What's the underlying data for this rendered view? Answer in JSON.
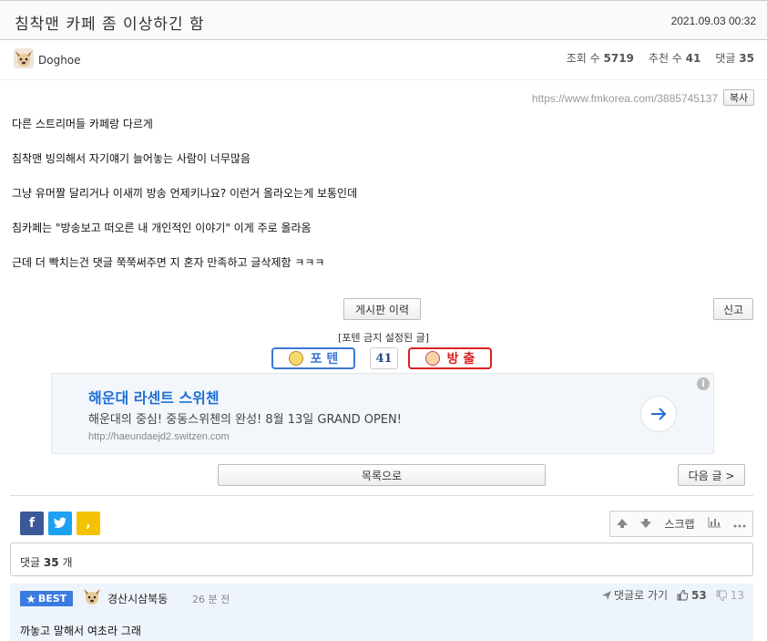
{
  "post": {
    "title": "침착맨 카페 좀 이상하긴 함",
    "datetime": "2021.09.03 00:32",
    "author": "Doghoe",
    "stats": {
      "views_label": "조회 수",
      "views": "5719",
      "recommend_label": "추천 수",
      "recommend": "41",
      "comments_label": "댓글",
      "comments": "35"
    },
    "url": "https://www.fmkorea.com/3885745137",
    "copy_label": "복사",
    "paragraphs": [
      "다른 스트리머들 카페랑 다르게",
      "침착맨 빙의해서 자기얘기 늘어놓는 사람이 너무많음",
      "그냥 유머짤 달리거나 이새끼 방송 언제키나요? 이런거 올라오는게 보통인데",
      "침카페는 \"방송보고 떠오른 내 개인적인 이야기\" 이게 주로 올라옴",
      "근데 더 빡치는건 댓글 쭉쭉써주면 지 혼자 만족하고 글삭제함 ㅋㅋㅋ"
    ]
  },
  "actions": {
    "history_label": "게시판 이력",
    "report_label": "신고",
    "notice": "[포텐 금지 설정된 글]",
    "poten_label": "포 텐",
    "vote_count": "41",
    "bangchul_label": "방 출",
    "list_label": "목록으로",
    "next_label": "다음 글 >"
  },
  "ad": {
    "title": "해운대 라센트 스위첸",
    "desc": "해운대의 중심! 중동스위첸의 완성! 8월 13일 GRAND OPEN!",
    "url": "http://haeundaejd2.switzen.com",
    "info": "i"
  },
  "share": {
    "facebook": "f",
    "twitter": "t",
    "kakao": ","
  },
  "toolbox": {
    "scrap_label": "스크랩"
  },
  "comments": {
    "count_label": "댓글",
    "count": "35",
    "count_unit": "개",
    "best": {
      "badge": "BEST",
      "nick": "경산시삼북동",
      "time": "26 분 전",
      "goto_label": "댓글로 가기",
      "up": "53",
      "down": "13",
      "text": "까놓고 말해서 여초라 그래"
    }
  },
  "colors": {
    "accent_blue": "#3a78d2",
    "bangchul_red": "#dd2222",
    "facebook": "#3b5998",
    "twitter": "#1da1f2",
    "kakao": "#f4c200",
    "best_bg": "#eef4fb"
  }
}
